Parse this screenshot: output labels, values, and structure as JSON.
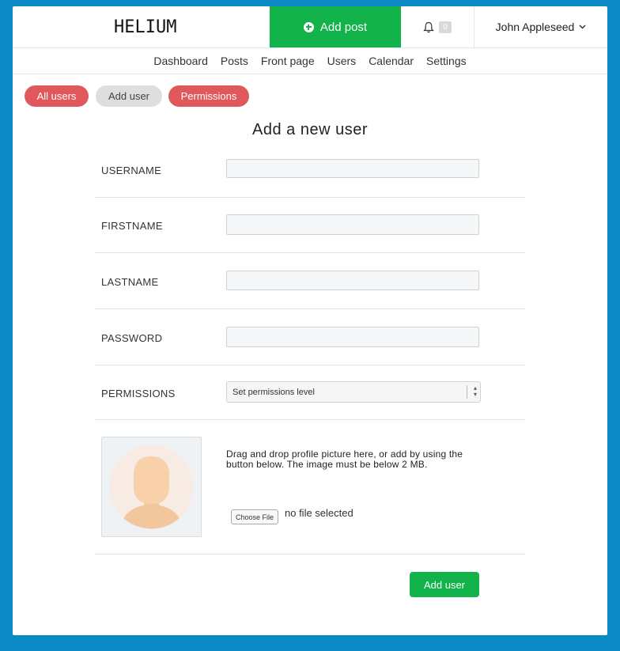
{
  "header": {
    "logo": "HELIUM",
    "add_post_label": "Add post",
    "notification_count": "0",
    "user_name": "John Appleseed"
  },
  "nav": {
    "items": [
      "Dashboard",
      "Posts",
      "Front page",
      "Users",
      "Calendar",
      "Settings"
    ]
  },
  "pills": {
    "all_users": "All users",
    "add_user": "Add user",
    "permissions": "Permissions"
  },
  "form": {
    "title": "Add a new user",
    "username_label": "USERNAME",
    "firstname_label": "FIRSTNAME",
    "lastname_label": "LASTNAME",
    "password_label": "PASSWORD",
    "permissions_label": "PERMISSIONS",
    "permissions_selected": "Set permissions level",
    "drop_text": "Drag and drop profile picture here, or add by using the button below. The image must be below 2 MB.",
    "choose_file_label": "Choose File",
    "file_status": "no file selected",
    "submit_label": "Add user"
  },
  "colors": {
    "background": "#0c8ac5",
    "green": "#12b34a",
    "red": "#e0585c",
    "grey_pill": "#dedede"
  }
}
